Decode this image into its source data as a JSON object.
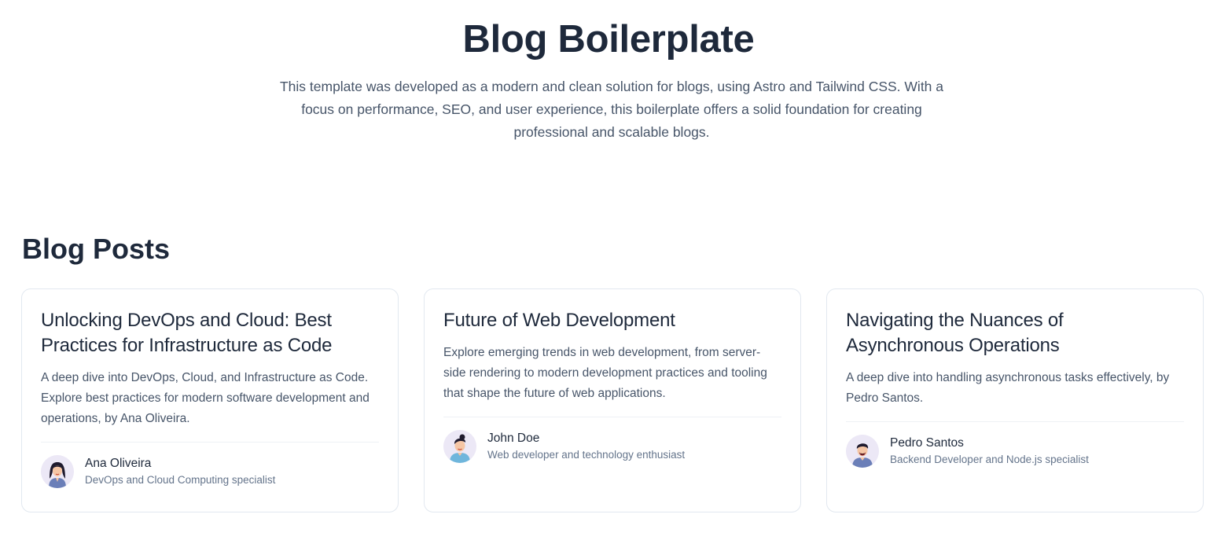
{
  "hero": {
    "title": "Blog Boilerplate",
    "description": "This template was developed as a modern and clean solution for blogs, using Astro and Tailwind CSS. With a focus on performance, SEO, and user experience, this boilerplate offers a solid foundation for creating professional and scalable blogs."
  },
  "posts_section": {
    "title": "Blog Posts",
    "posts": [
      {
        "title": "Unlocking DevOps and Cloud: Best Practices for Infrastructure as Code",
        "description": "A deep dive into DevOps, Cloud, and Infrastructure as Code. Explore best practices for modern software development and operations, by Ana Oliveira.",
        "author": {
          "name": "Ana Oliveira",
          "role": "DevOps and Cloud Computing specialist",
          "avatar_icon": "female-avatar-icon"
        }
      },
      {
        "title": "Future of Web Development",
        "description": "Explore emerging trends in web development, from server-side rendering to modern development practices and tooling that shape the future of web applications.",
        "author": {
          "name": "John Doe",
          "role": "Web developer and technology enthusiast",
          "avatar_icon": "male-avatar-icon"
        }
      },
      {
        "title": "Navigating the Nuances of Asynchronous Operations",
        "description": "A deep dive into handling asynchronous tasks effectively, by Pedro Santos.",
        "author": {
          "name": "Pedro Santos",
          "role": "Backend Developer and Node.js specialist",
          "avatar_icon": "male-avatar-icon"
        }
      }
    ]
  },
  "colors": {
    "heading": "#1e293b",
    "body_text": "#475569",
    "muted_text": "#64748b",
    "card_border": "#e2e8f0",
    "avatar_bg": "#ece8f6"
  }
}
